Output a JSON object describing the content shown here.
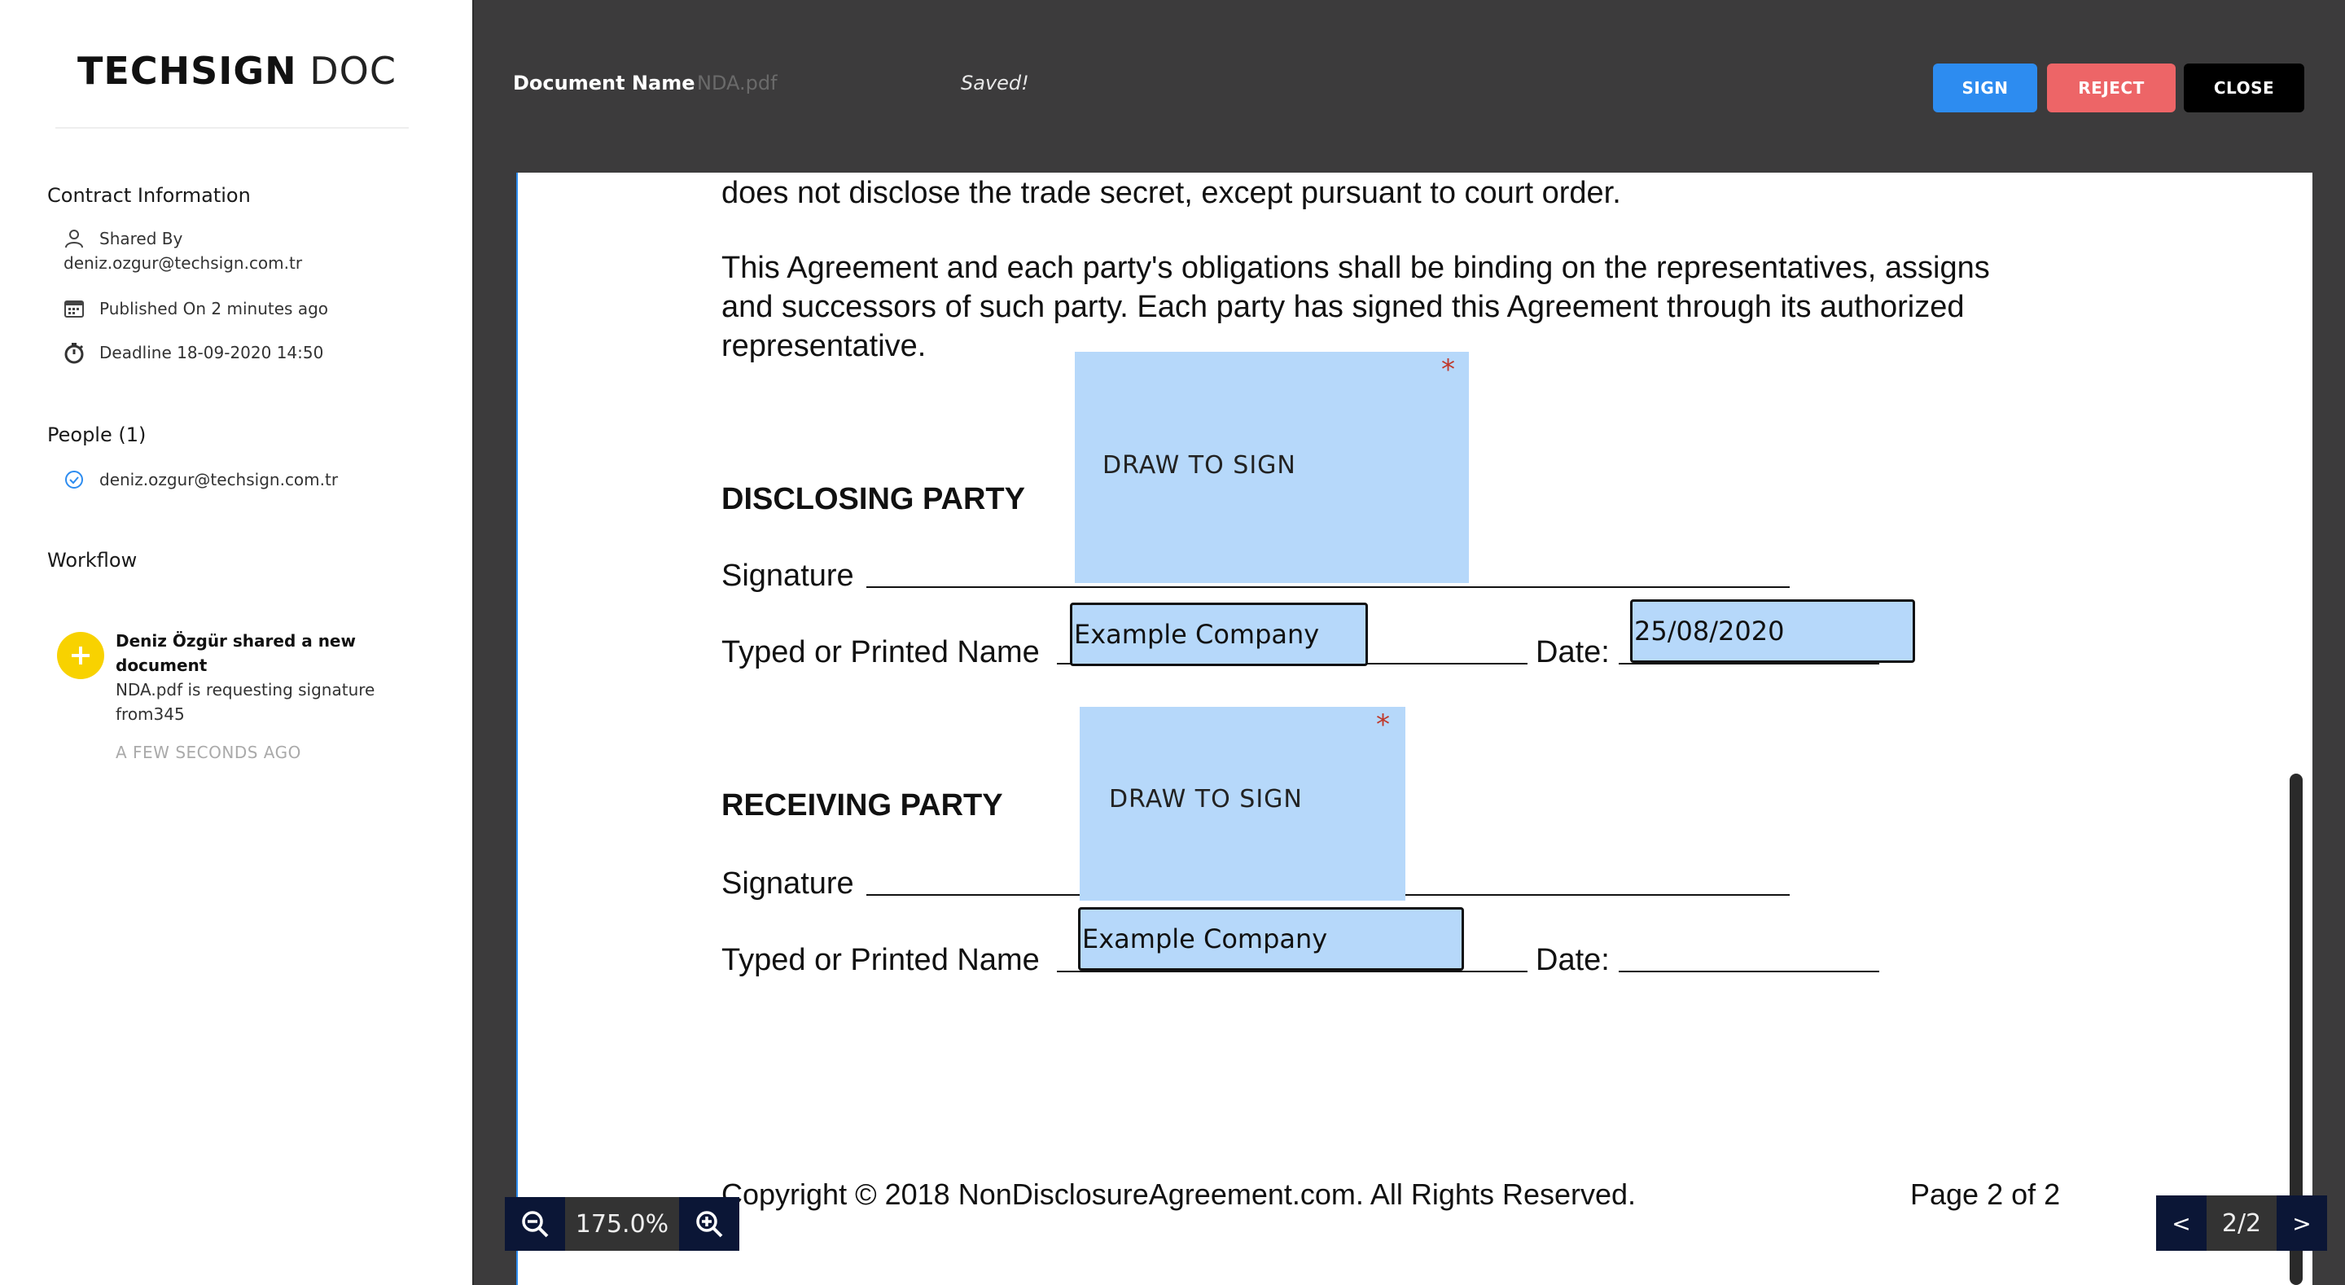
{
  "sidebar": {
    "brand_bold": "TECHSIGN",
    "brand_light": "DOC",
    "contract_title": "Contract Information",
    "shared_by_label": "Shared By",
    "shared_by_email": "deniz.ozgur@techsign.com.tr",
    "published": "Published On 2 minutes ago",
    "deadline": "Deadline 18-09-2020 14:50",
    "people_title": "People (1)",
    "person_email": "deniz.ozgur@techsign.com.tr",
    "workflow_title": "Workflow",
    "workflow_event_title": "Deniz Özgür shared a new document",
    "workflow_event_detail": "NDA.pdf is requesting signature from345",
    "workflow_event_time": "A FEW SECONDS AGO"
  },
  "topbar": {
    "doc_name_label": "Document Name",
    "doc_name_value": "NDA.pdf",
    "status": "Saved!",
    "sign": "SIGN",
    "reject": "REJECT",
    "close": "CLOSE"
  },
  "document": {
    "line1": "does not disclose the trade secret, except pursuant to court order.",
    "para2_l1": "This Agreement and each party's obligations shall be binding on the representatives, assigns",
    "para2_l2": "and successors of such party. Each party has signed this Agreement through its authorized",
    "para2_l3": "representative.",
    "disclosing": "DISCLOSING PARTY",
    "signature_label": "Signature",
    "name_label": "Typed or Printed Name",
    "date_label": "Date:",
    "receiving": "RECEIVING PARTY",
    "footer_copyright": "Copyright © 2018 NonDisclosureAgreement.com. All Rights Reserved.",
    "footer_page": "Page 2 of 2"
  },
  "fields": {
    "draw_to_sign": "DRAW TO SIGN",
    "required_mark": "*",
    "disclosing_name": "Example Company",
    "disclosing_date": "25/08/2020",
    "receiving_name": "Example Company"
  },
  "controls": {
    "zoom_value": "175.0%",
    "prev": "<",
    "next": ">",
    "page_indicator": "2/2"
  },
  "colors": {
    "accent": "#2d8cf0",
    "reject": "#ed6567",
    "field_fill": "#b6d8fa",
    "workflow_dot": "#f8d200"
  }
}
